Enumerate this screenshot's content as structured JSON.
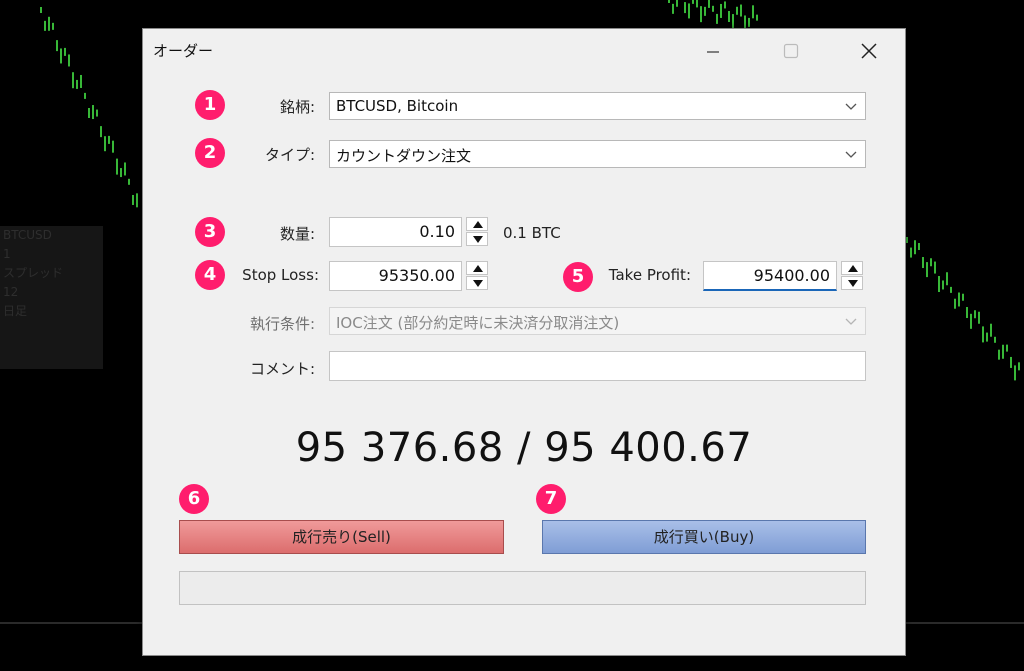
{
  "window": {
    "title": "オーダー",
    "controls": [
      "minimize-icon",
      "maximize-icon",
      "close-icon"
    ]
  },
  "annotations": [
    "1",
    "2",
    "3",
    "4",
    "5",
    "6",
    "7"
  ],
  "background_chart": {
    "candle_color": "#38b838",
    "background": "#000000",
    "info_panel_lines": [
      "BTCUSD",
      "1",
      "スプレッド",
      "12",
      "日足"
    ]
  },
  "form": {
    "symbol": {
      "label": "銘柄:",
      "value": "BTCUSD, Bitcoin"
    },
    "type": {
      "label": "タイプ:",
      "value": "カウントダウン注文"
    },
    "volume": {
      "label": "数量:",
      "value": "0.10",
      "unit": "0.1 BTC"
    },
    "stop_loss": {
      "label": "Stop Loss:",
      "value": "95350.00"
    },
    "take_profit": {
      "label": "Take Profit:",
      "value": "95400.00"
    },
    "fill_policy": {
      "label": "執行条件:",
      "value": "IOC注文 (部分約定時に未決済分取消注文)"
    },
    "comment": {
      "label": "コメント:",
      "value": ""
    }
  },
  "quote": "95 376.68 / 95 400.67",
  "actions": {
    "sell": "成行売り(Sell)",
    "buy": "成行買い(Buy)"
  },
  "colors": {
    "badge": "#ff1d6d",
    "sell_button": "#e27f7f",
    "buy_button": "#92acdd",
    "focus": "#1a66b8"
  }
}
